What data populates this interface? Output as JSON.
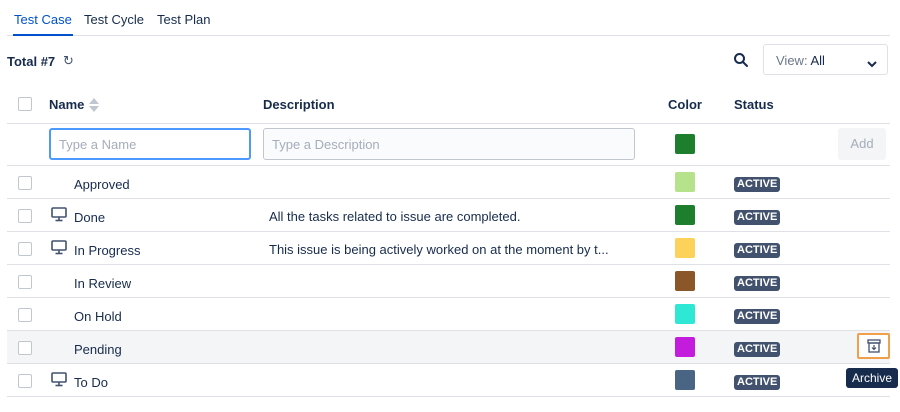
{
  "tabs": [
    {
      "label": "Test Case",
      "active": true
    },
    {
      "label": "Test Cycle",
      "active": false
    },
    {
      "label": "Test Plan",
      "active": false
    }
  ],
  "toolbar": {
    "total_label": "Total #7",
    "refresh_glyph": "↻",
    "view_prefix": "View: ",
    "view_value": "All"
  },
  "columns": {
    "name": "Name",
    "description": "Description",
    "color": "Color",
    "status": "Status"
  },
  "new_row": {
    "name_placeholder": "Type a Name",
    "desc_placeholder": "Type a Description",
    "color": "#1d7f2d",
    "add_label": "Add"
  },
  "rows": [
    {
      "name": "Approved",
      "description": "",
      "color": "#b5e28a",
      "status": "ACTIVE",
      "icon": ""
    },
    {
      "name": "Done",
      "description": "All the tasks related to issue are completed.",
      "color": "#1d7f2d",
      "status": "ACTIVE",
      "icon": "monitor-icon"
    },
    {
      "name": "In Progress",
      "description": "This issue is being actively worked on at the moment by t...",
      "color": "#fdd25a",
      "status": "ACTIVE",
      "icon": "monitor-icon"
    },
    {
      "name": "In Review",
      "description": "",
      "color": "#8b5728",
      "status": "ACTIVE",
      "icon": ""
    },
    {
      "name": "On Hold",
      "description": "",
      "color": "#2ee8d5",
      "status": "ACTIVE",
      "icon": ""
    },
    {
      "name": "Pending",
      "description": "",
      "color": "#c41cdc",
      "status": "ACTIVE",
      "icon": ""
    },
    {
      "name": "To Do",
      "description": "",
      "color": "#4a6583",
      "status": "ACTIVE",
      "icon": "monitor-icon"
    }
  ],
  "tooltip": "Archive"
}
